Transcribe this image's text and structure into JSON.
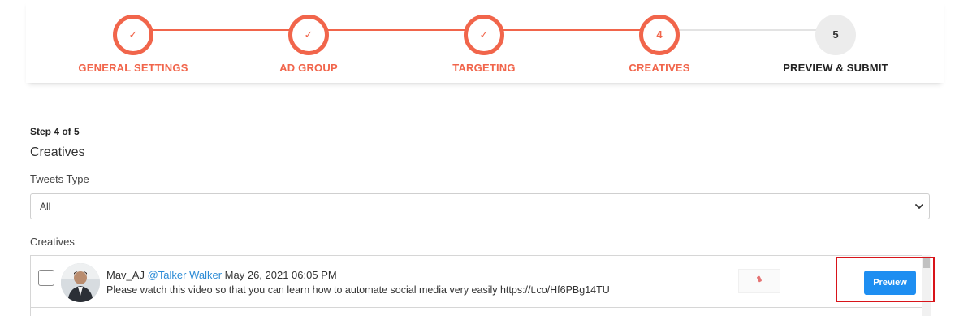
{
  "stepper": {
    "steps": [
      {
        "marker": "✓",
        "label": "GENERAL SETTINGS",
        "state": "done"
      },
      {
        "marker": "✓",
        "label": "AD GROUP",
        "state": "done"
      },
      {
        "marker": "✓",
        "label": "TARGETING",
        "state": "done"
      },
      {
        "marker": "4",
        "label": "CREATIVES",
        "state": "current"
      },
      {
        "marker": "5",
        "label": "PREVIEW & SUBMIT",
        "state": "pending"
      }
    ]
  },
  "form": {
    "counter": "Step 4 of 5",
    "title": "Creatives",
    "tweets_type_label": "Tweets Type",
    "tweets_type_value": "All",
    "creatives_label": "Creatives"
  },
  "creatives": [
    {
      "user": "Mav_AJ",
      "handle": "@Talker Walker",
      "date": "May 26, 2021 06:05 PM",
      "text": "Please watch this video so that you can learn how to automate social media very easily https://t.co/Hf6PBg14TU",
      "action": "Preview"
    }
  ],
  "colors": {
    "accent": "#f1654b",
    "button": "#1e8ef1",
    "highlight": "#d8141a",
    "link": "#2d8cd6"
  },
  "icons": [
    "check-icon",
    "chevron-down-icon",
    "avatar",
    "media-thumbnail"
  ]
}
